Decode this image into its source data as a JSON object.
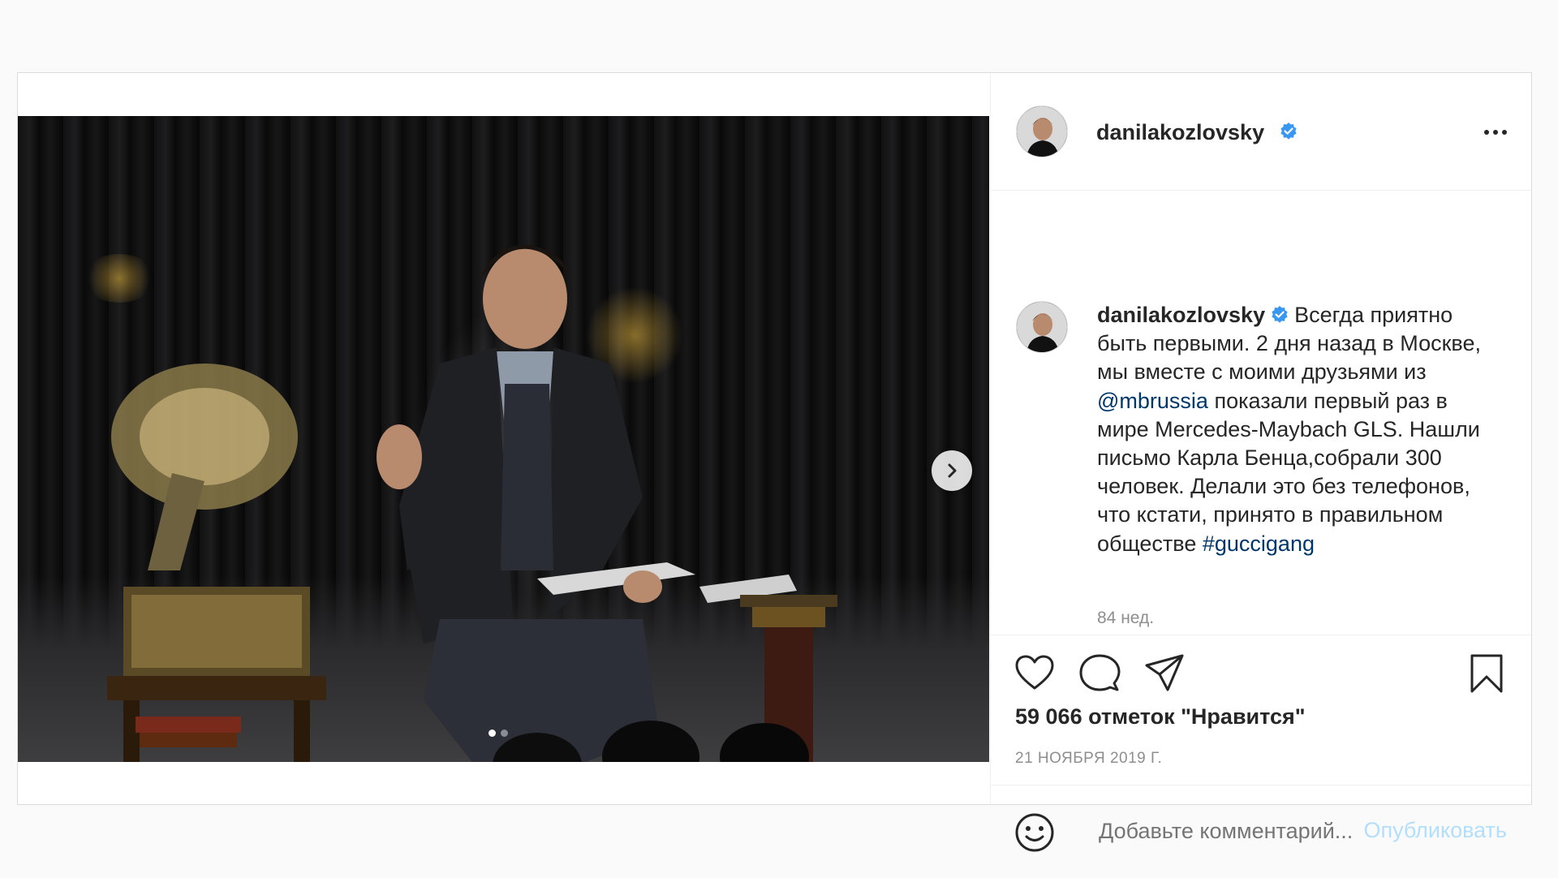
{
  "post": {
    "author": "danilakozlovsky",
    "verified": true,
    "caption_text": "Всегда приятно быть первыми. 2 дня назад в Москве, мы вместе с моими друзьями из",
    "mention": "@mbrussia",
    "caption_text_2": "показали первый раз в мире Mercedes-Maybach GLS. Нашли письмо Карла Бенца,собрали 300 человек. Делали это без телефонов, что кстати, принято в правильном обществе",
    "hashtag": "#guccigang",
    "time_ago": "84 нед.",
    "likes": "59 066 отметок \"Нравится\"",
    "date": "21 НОЯБРЯ 2019 Г.",
    "comment_placeholder": "Добавьте комментарий...",
    "publish_label": "Опубликовать",
    "carousel": {
      "total_slides": 2,
      "active_slide": 1
    }
  },
  "icons": {
    "like": "heart-icon",
    "comment": "speech-bubble-icon",
    "share": "paper-plane-icon",
    "save": "bookmark-icon",
    "emoji": "smiley-icon",
    "more": "ellipsis-icon",
    "next": "chevron-right-icon",
    "verified": "verified-badge-icon"
  },
  "colors": {
    "link": "#00376b",
    "verified": "#3897f0",
    "muted": "#8e8e8e",
    "publish_disabled": "#b2dffc"
  }
}
